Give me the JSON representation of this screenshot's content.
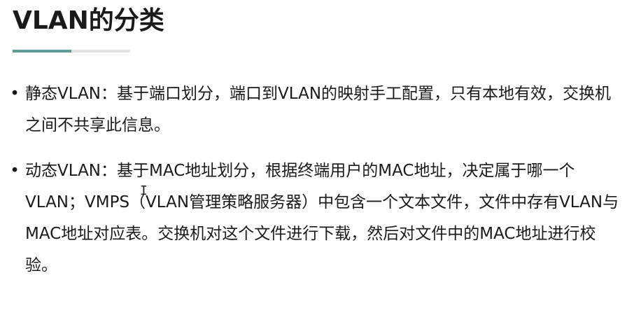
{
  "slide": {
    "title": "VLAN的分类",
    "bullet_symbol": "•",
    "bullets": [
      "静态VLAN：基于端口划分，端口到VLAN的映射手工配置，只有本地有效，交换机之间不共享此信息。",
      "动态VLAN：基于MAC地址划分，根据终端用户的MAC地址，决定属于哪一个VLAN；VMPS（VLAN管理策略服务器）中包含一个文本文件，文件中存有VLAN与MAC地址对应表。交换机对这个文件进行下载，然后对文件中的MAC地址进行校验。"
    ]
  },
  "colors": {
    "accent": "#5f9c95",
    "underline_track": "#e3e3e3",
    "text": "#1a1a1a"
  },
  "cursor": {
    "icon": "text-cursor-icon",
    "glyph": "I"
  }
}
